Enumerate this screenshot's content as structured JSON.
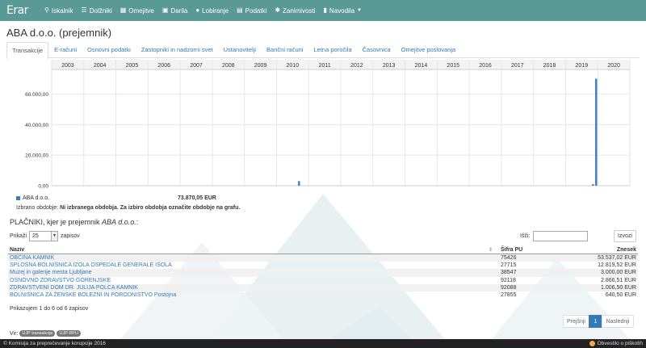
{
  "app": {
    "brand": "Erar"
  },
  "nav": {
    "items": [
      {
        "label": "Iskalnik",
        "icon": "search-icon"
      },
      {
        "label": "Dolžniki",
        "icon": "list-icon"
      },
      {
        "label": "Omejitve",
        "icon": "grid-icon"
      },
      {
        "label": "Darila",
        "icon": "gift-icon"
      },
      {
        "label": "Lobiranje",
        "icon": "user-icon"
      },
      {
        "label": "Podatki",
        "icon": "server-icon"
      },
      {
        "label": "Zanimivosti",
        "icon": "asterisk-icon"
      },
      {
        "label": "Navodila",
        "icon": "book-icon"
      }
    ]
  },
  "page": {
    "title": "ABA d.o.o. (prejemnik)"
  },
  "tabs": [
    {
      "label": "Transakcije",
      "active": true
    },
    {
      "label": "E-računi",
      "active": false
    },
    {
      "label": "Osnovni podatki",
      "active": false
    },
    {
      "label": "Zastopniki in nadzorni svet",
      "active": false
    },
    {
      "label": "Ustanovitelji",
      "active": false
    },
    {
      "label": "Bančni računi",
      "active": false
    },
    {
      "label": "Letna poročila",
      "active": false
    },
    {
      "label": "Časovnica",
      "active": false
    },
    {
      "label": "Omejitve poslovanja",
      "active": false
    }
  ],
  "chart_data": {
    "type": "bar",
    "title": "",
    "xlabel": "",
    "ylabel": "",
    "categories": [
      "2003",
      "2004",
      "2005",
      "2006",
      "2007",
      "2008",
      "2009",
      "2010",
      "2011",
      "2012",
      "2013",
      "2014",
      "2015",
      "2016",
      "2017",
      "2018",
      "2019",
      "2020"
    ],
    "yticks": [
      "0,00",
      "20.000,00",
      "40.000,00",
      "60.000,00"
    ],
    "ylim": [
      0,
      75000
    ],
    "grid": true,
    "bar_color": "#3a7ec2",
    "series": [
      {
        "name": "ABA d.o.o.",
        "points": [
          {
            "x": 2010.7,
            "y": 3000
          },
          {
            "x": 2019.85,
            "y": 1000
          },
          {
            "x": 2019.95,
            "y": 70000
          }
        ]
      }
    ]
  },
  "legend": {
    "label": "ABA d.o.o.",
    "total": "73.870,05 EUR"
  },
  "period": {
    "label": "Izbrano obdobje:",
    "value": "Ni izbranega obdobja. Za izbiro obdobja označite obdobje na grafu."
  },
  "section": {
    "title_prefix": "PLAČNIKI, kjer je prejemnik ",
    "title_entity": "ABA d.o.o.",
    "title_suffix": ":"
  },
  "table_controls": {
    "show_label": "Prikaži",
    "page_size": "25",
    "entries_label": "zapisov",
    "search_label": "Išči:",
    "export_label": "Izvozi"
  },
  "table": {
    "headers": {
      "name": "Naziv",
      "pu": "Šifra PU",
      "amount": "Znesek"
    },
    "rows": [
      {
        "name": "OBČINA KAMNIK",
        "pu": "75426",
        "amount": "53.537,02 EUR"
      },
      {
        "name": "SPLOŠNA BOLNIŠNICA IZOLA OSPEDALE GENERALE ISOLA",
        "pu": "27715",
        "amount": "12.819,52 EUR"
      },
      {
        "name": "Muzej in galerije mesta Ljubljane",
        "pu": "38547",
        "amount": "3.000,00 EUR"
      },
      {
        "name": "OSNOVNO ZDRAVSTVO GORENJSKE",
        "pu": "92118",
        "amount": "2.866,51 EUR"
      },
      {
        "name": "ZDRAVSTVENI DOM DR. JULIJA POLCA KAMNIK",
        "pu": "92088",
        "amount": "1.006,50 EUR"
      },
      {
        "name": "BOLNIŠNICA ZA ŽENSKE BOLEZNI IN PORODNIŠTVO Postojna",
        "pu": "27855",
        "amount": "640,50 EUR"
      }
    ]
  },
  "info": "Prikazujem 1 do 6 od 6 zapisov",
  "pagination": {
    "prev": "Prejšnji",
    "current": "1",
    "next": "Naslednji"
  },
  "sources": {
    "label": "Vir:",
    "badges": [
      "UJP transakcije",
      "UJP RPU"
    ]
  },
  "footer": {
    "copyright": "© Komisija za preprečevanje korupcije 2016",
    "notice": "Obvestilo o piškotih"
  }
}
